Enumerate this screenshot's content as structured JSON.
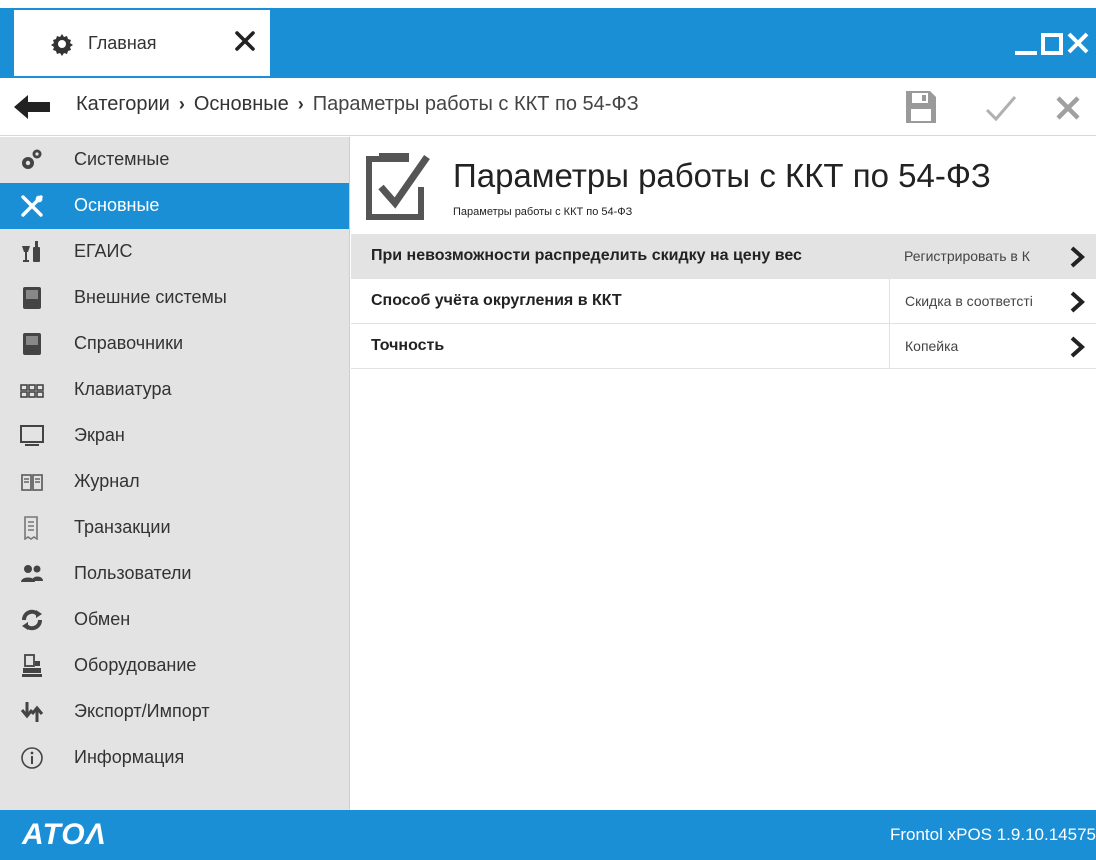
{
  "tab": {
    "label": "Главная"
  },
  "breadcrumb": {
    "items": [
      "Категории",
      "Основные",
      "Параметры работы с ККТ по 54-ФЗ"
    ],
    "separator": "›"
  },
  "sidebar": {
    "items": [
      {
        "label": "Системные",
        "icon": "gears-icon"
      },
      {
        "label": "Основные",
        "icon": "tools-icon",
        "active": true
      },
      {
        "label": "ЕГАИС",
        "icon": "bottles-icon"
      },
      {
        "label": "Внешние системы",
        "icon": "book-icon"
      },
      {
        "label": "Справочники",
        "icon": "book-icon"
      },
      {
        "label": "Клавиатура",
        "icon": "keyboard-icon"
      },
      {
        "label": "Экран",
        "icon": "monitor-icon"
      },
      {
        "label": "Журнал",
        "icon": "open-book-icon"
      },
      {
        "label": "Транзакции",
        "icon": "receipt-icon"
      },
      {
        "label": "Пользователи",
        "icon": "users-icon"
      },
      {
        "label": "Обмен",
        "icon": "sync-icon"
      },
      {
        "label": "Оборудование",
        "icon": "cash-register-icon"
      },
      {
        "label": "Экспорт/Импорт",
        "icon": "transfer-icon"
      },
      {
        "label": "Информация",
        "icon": "info-icon"
      }
    ]
  },
  "main": {
    "title": "Параметры работы с ККТ по 54-ФЗ",
    "subtitle": "Параметры работы с ККТ по 54-ФЗ",
    "rows": [
      {
        "label": "При невозможности распределить скидку на цену вес",
        "value": "Регистрировать в К"
      },
      {
        "label": "Способ учёта округления в ККТ",
        "value": "Скидка в соответсті"
      },
      {
        "label": "Точность",
        "value": "Копейка"
      }
    ]
  },
  "footer": {
    "brand": "ATOΛ",
    "version": "Frontol xPOS 1.9.10.14575"
  },
  "colors": {
    "accent": "#1a8fd6",
    "sidebar_bg": "#e3e3e3",
    "highlight_row": "#e3e3e3"
  }
}
